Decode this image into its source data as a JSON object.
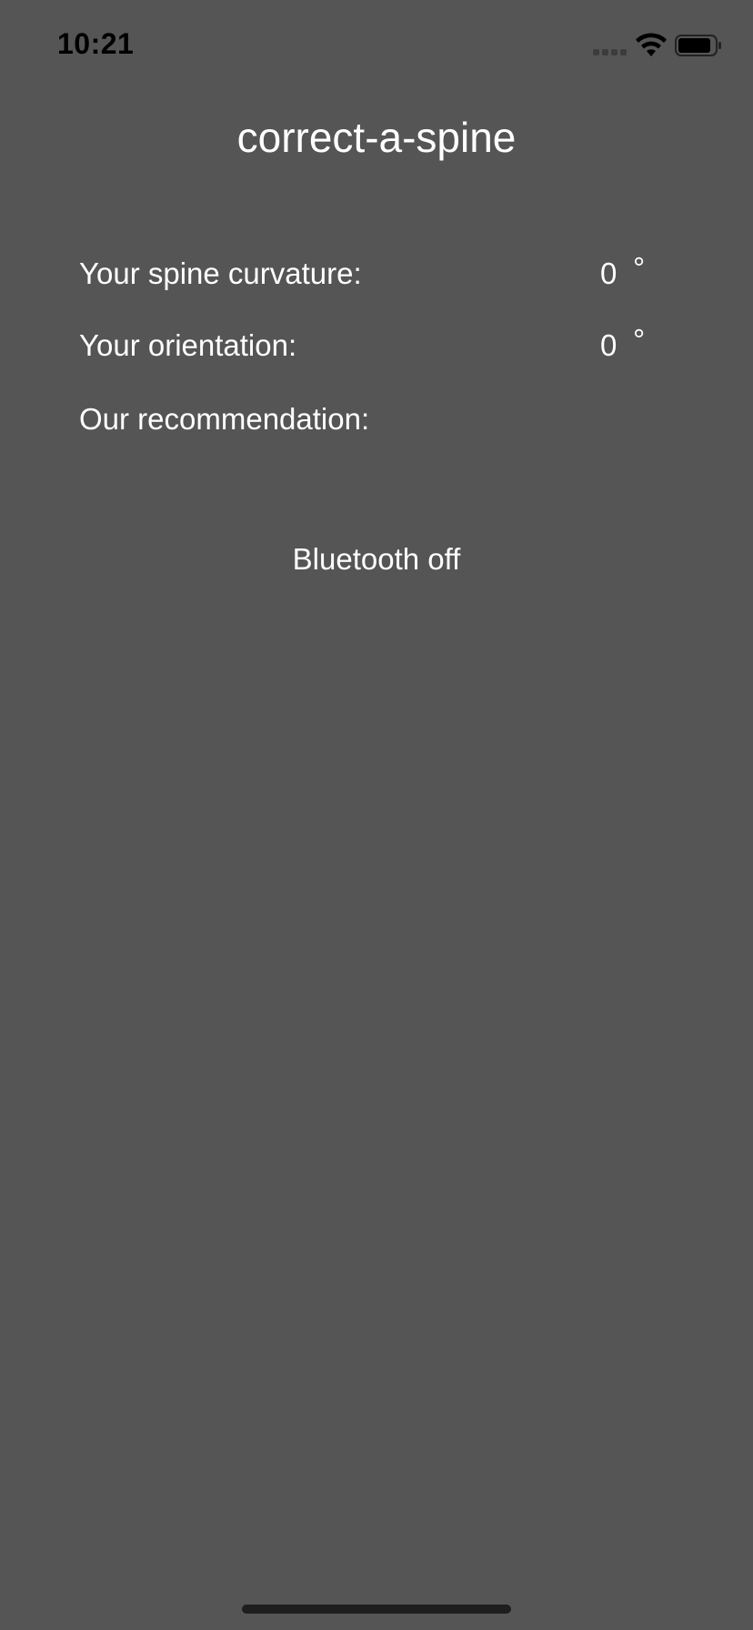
{
  "status_bar": {
    "time": "10:21"
  },
  "app": {
    "title": "correct-a-spine"
  },
  "readings": [
    {
      "label": "Your spine curvature:",
      "value": "0",
      "unit": "°"
    },
    {
      "label": "Your orientation:",
      "value": "0",
      "unit": "°"
    }
  ],
  "recommendation": {
    "label": "Our recommendation:",
    "value": ""
  },
  "bluetooth": {
    "status": "Bluetooth off"
  },
  "colors": {
    "background": "#555555",
    "text": "#ffffff",
    "status_text": "#000000"
  }
}
